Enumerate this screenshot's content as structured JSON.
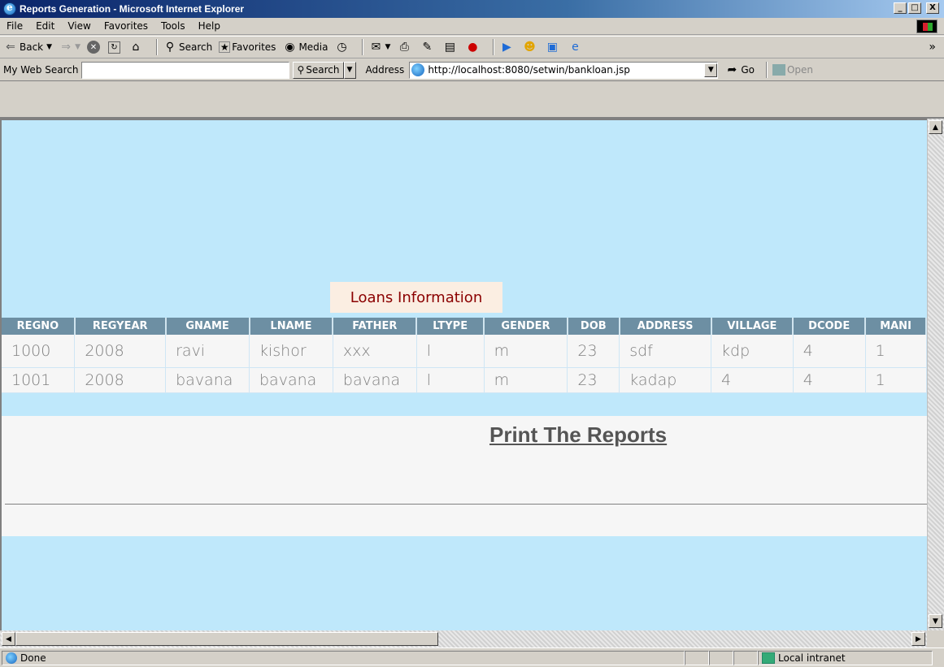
{
  "window": {
    "title": "Reports Generation - Microsoft Internet Explorer",
    "controls": {
      "minimize": "_",
      "maximize": "в",
      "close": "X"
    }
  },
  "menu": {
    "items": [
      {
        "label": "File"
      },
      {
        "label": "Edit"
      },
      {
        "label": "View"
      },
      {
        "label": "Favorites"
      },
      {
        "label": "Tools"
      },
      {
        "label": "Help"
      }
    ]
  },
  "toolbar": {
    "back_label": "Back",
    "search_label": "Search",
    "favorites_label": "Favorites",
    "media_label": "Media"
  },
  "addressbar": {
    "my_web_search_label": "My Web Search",
    "search_input_value": "",
    "search_button_label": "Search",
    "address_label": "Address",
    "url": "http://localhost:8080/setwin/bankloan.jsp",
    "go_label": "Go",
    "open_label": "Open"
  },
  "page": {
    "heading": "Loans Information",
    "table": {
      "headers": [
        "REGNO",
        "REGYEAR",
        "GNAME",
        "LNAME",
        "FATHER",
        "LTYPE",
        "GENDER",
        "DOB",
        "ADDRESS",
        "VILLAGE",
        "DCODE",
        "MANI"
      ],
      "rows": [
        [
          "1000",
          "2008",
          "ravi",
          "kishor",
          "xxx",
          "l",
          "m",
          "23",
          "sdf",
          "kdp",
          "4",
          "1"
        ],
        [
          "1001",
          "2008",
          "bavana",
          "bavana",
          "bavana",
          "l",
          "m",
          "23",
          "kadap",
          "4",
          "4",
          "1"
        ]
      ]
    },
    "print_link": "Print The Reports"
  },
  "status": {
    "text": "Done",
    "zone": "Local intranet"
  }
}
